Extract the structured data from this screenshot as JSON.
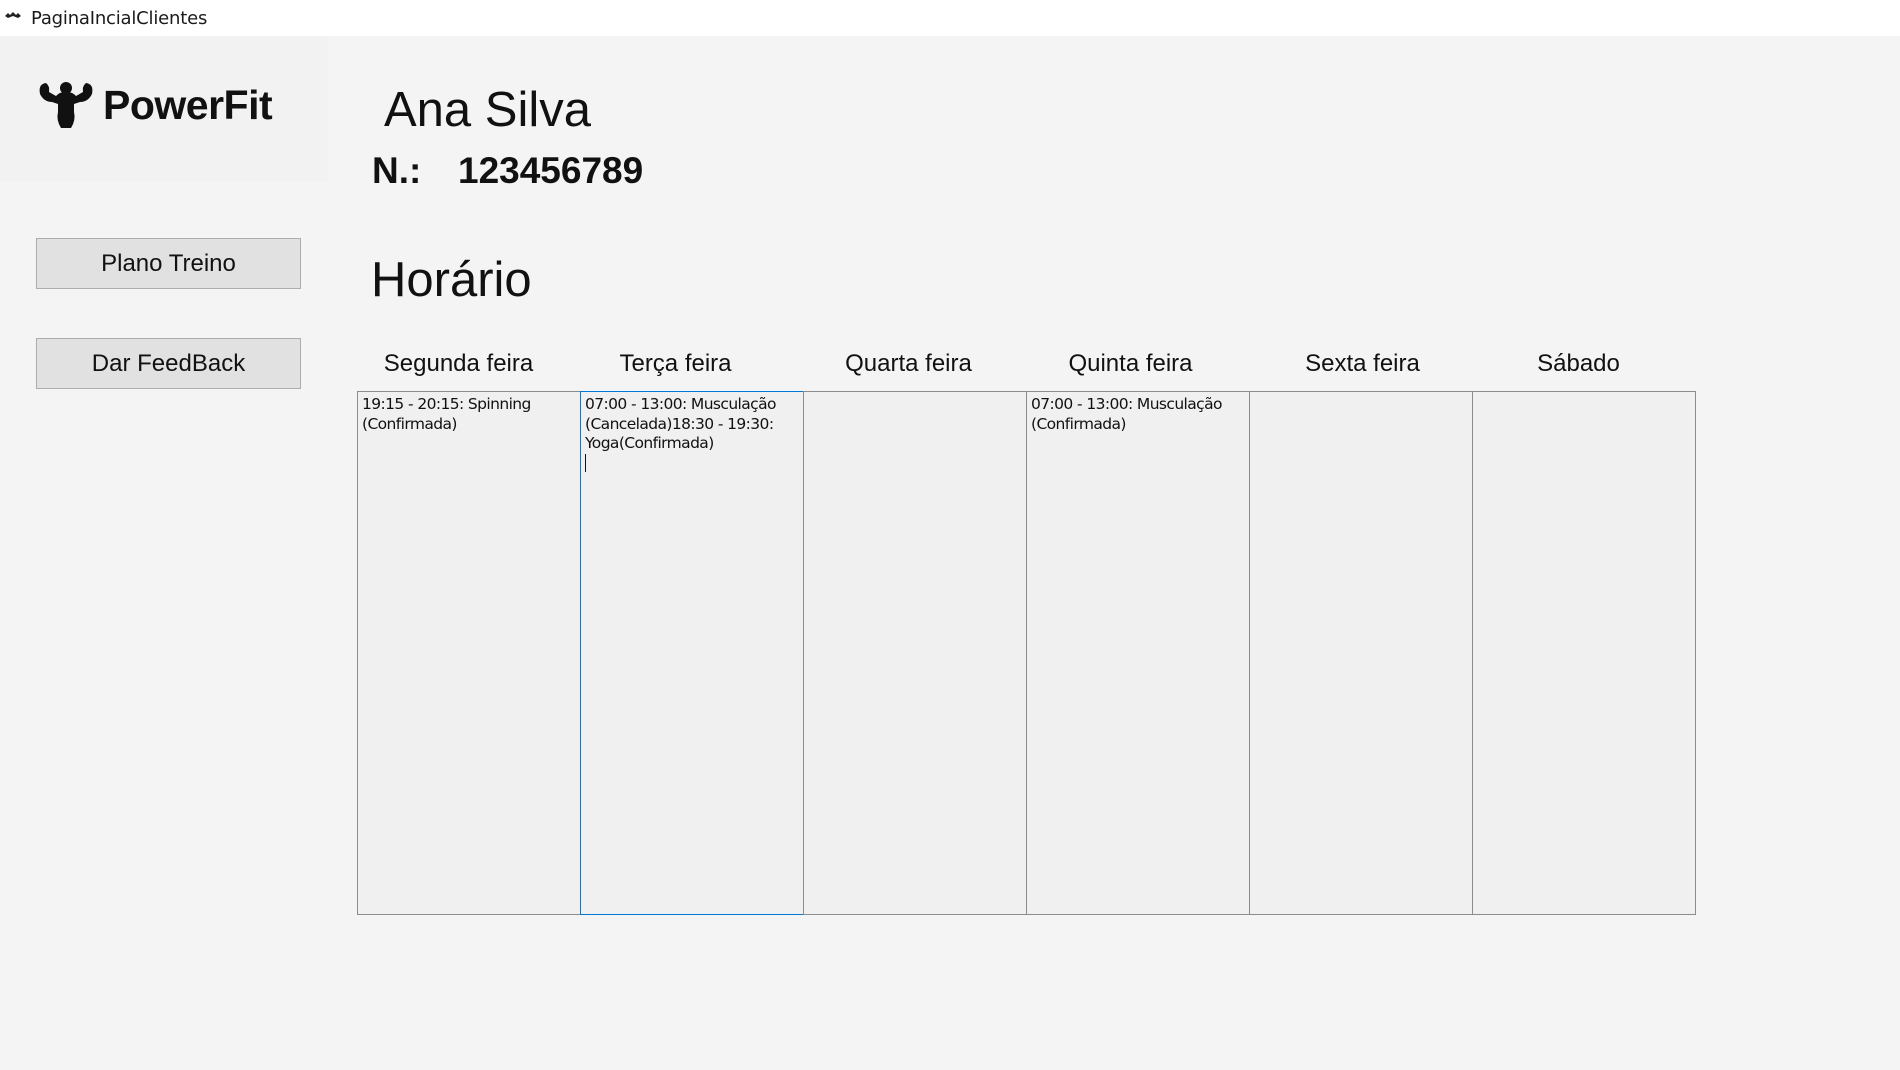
{
  "window": {
    "title": "PaginaIncialClientes"
  },
  "brand": {
    "name": "PowerFit"
  },
  "nav": {
    "plan_button": "Plano Treino",
    "feedback_button": "Dar FeedBack"
  },
  "client": {
    "name": "Ana Silva",
    "number_label": "N.:",
    "number": "123456789"
  },
  "schedule": {
    "title": "Horário",
    "days": [
      {
        "label": "Segunda feira",
        "content": "19:15 - 20:15: Spinning (Confirmada)"
      },
      {
        "label": "Terça feira",
        "content": "07:00 - 13:00: Musculação (Cancelada)18:30 - 19:30: Yoga(Confirmada)"
      },
      {
        "label": "Quarta feira",
        "content": ""
      },
      {
        "label": "Quinta feira",
        "content": "07:00 - 13:00: Musculação (Confirmada)"
      },
      {
        "label": "Sexta feira",
        "content": ""
      },
      {
        "label": "Sábado",
        "content": ""
      }
    ],
    "focused_day_index": 1
  },
  "colors": {
    "focus_border": "#0078d7",
    "button_bg": "#e1e1e1"
  }
}
